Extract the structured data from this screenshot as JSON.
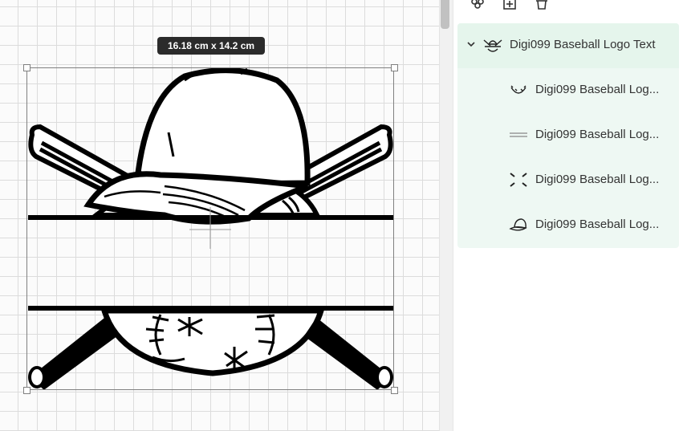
{
  "canvas": {
    "dimensions_label": "16.18  cm x 14.2  cm"
  },
  "toolbar": {
    "icons": [
      "group-icon",
      "add-layer-icon",
      "trash-icon"
    ]
  },
  "layers": {
    "group": {
      "label": "Digi099 Baseball Logo Text",
      "expanded": true,
      "thumbnail": "baseball-logo-thumbnail-icon"
    },
    "items": [
      {
        "label": "Digi099 Baseball Log...",
        "thumbnail": "baseball-thumbnail-icon"
      },
      {
        "label": "Digi099 Baseball Log...",
        "thumbnail": "lines-thumbnail-icon"
      },
      {
        "label": "Digi099 Baseball Log...",
        "thumbnail": "bats-thumbnail-icon"
      },
      {
        "label": "Digi099 Baseball Log...",
        "thumbnail": "cap-thumbnail-icon"
      }
    ]
  },
  "colors": {
    "selection_bg": "#e5f5ec",
    "group_bg": "#eef8f3",
    "badge_bg": "#2b2b2b",
    "artwork": "#000000"
  }
}
